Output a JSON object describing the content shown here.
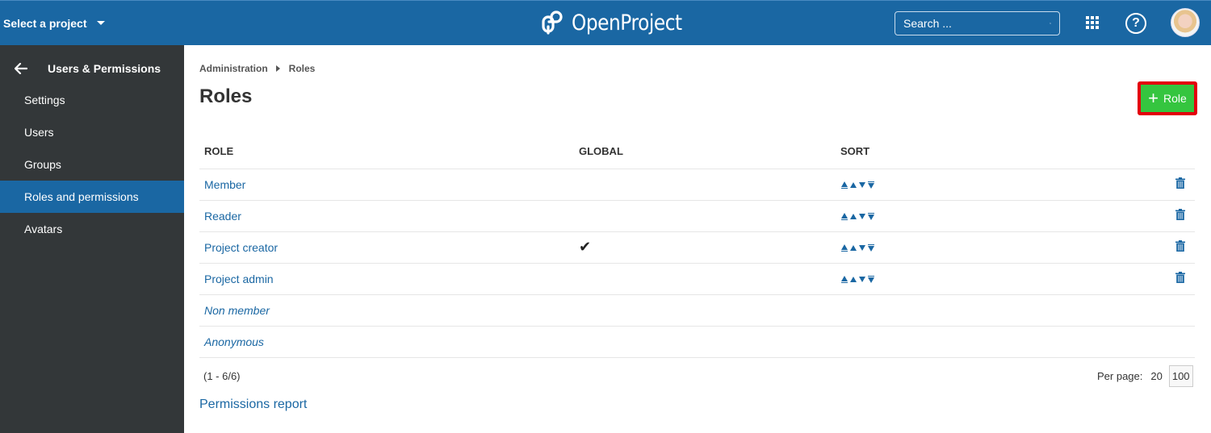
{
  "header": {
    "project_selector": "Select a project",
    "logo_text": "OpenProject",
    "search_placeholder": "Search ...",
    "help_symbol": "?",
    "colors": {
      "header_bg": "#1a67a3"
    }
  },
  "sidebar": {
    "title": "Users & Permissions",
    "items": [
      {
        "label": "Settings",
        "active": false
      },
      {
        "label": "Users",
        "active": false
      },
      {
        "label": "Groups",
        "active": false
      },
      {
        "label": "Roles and permissions",
        "active": true
      },
      {
        "label": "Avatars",
        "active": false
      }
    ]
  },
  "breadcrumb": [
    "Administration",
    "Roles"
  ],
  "page_title": "Roles",
  "add_button": {
    "icon": "plus-icon",
    "label": "Role",
    "color": "#35c53f",
    "highlight": "#e3000b"
  },
  "table": {
    "columns": [
      "ROLE",
      "GLOBAL",
      "SORT"
    ],
    "rows": [
      {
        "name": "Member",
        "global": false,
        "builtin": false,
        "sortable": true,
        "deletable": true
      },
      {
        "name": "Reader",
        "global": false,
        "builtin": false,
        "sortable": true,
        "deletable": true
      },
      {
        "name": "Project creator",
        "global": true,
        "builtin": false,
        "sortable": true,
        "deletable": true
      },
      {
        "name": "Project admin",
        "global": false,
        "builtin": false,
        "sortable": true,
        "deletable": true
      },
      {
        "name": "Non member",
        "global": false,
        "builtin": true,
        "sortable": false,
        "deletable": false
      },
      {
        "name": "Anonymous",
        "global": false,
        "builtin": true,
        "sortable": false,
        "deletable": false
      }
    ],
    "check_symbol": "✔"
  },
  "pagination": {
    "info": "(1 - 6/6)",
    "per_page_label": "Per page:",
    "options": [
      "20",
      "100"
    ],
    "selected": "100"
  },
  "permissions_report_link": "Permissions report"
}
